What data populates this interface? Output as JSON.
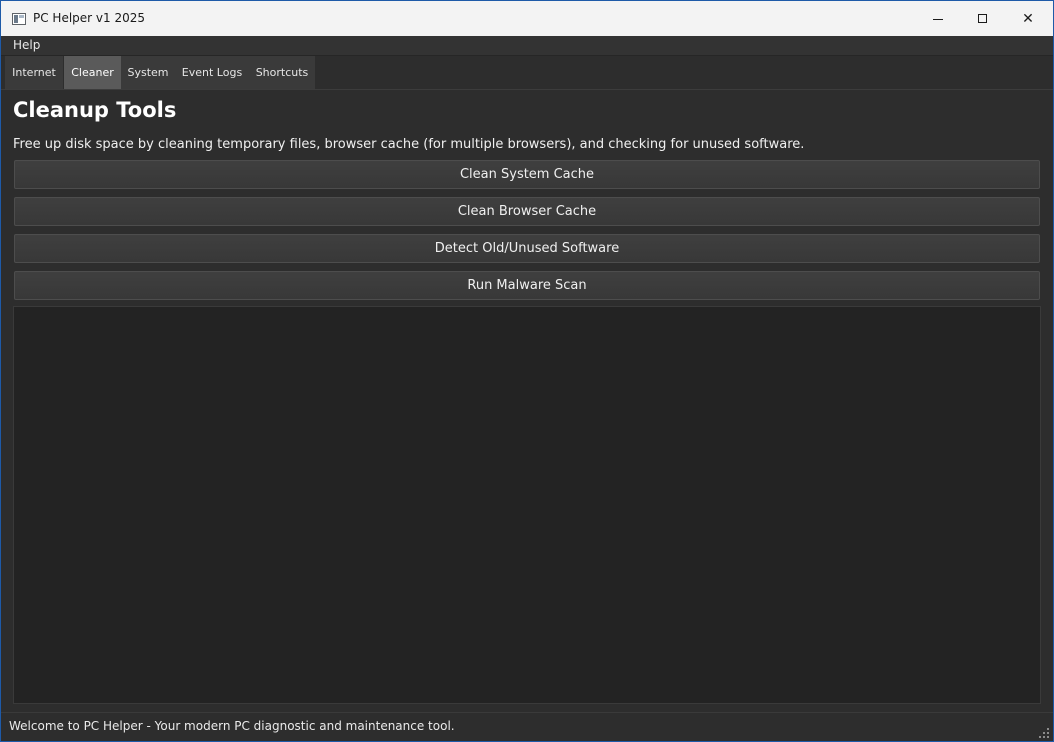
{
  "window": {
    "title": "PC Helper v1 2025",
    "icon": "app-window-icon",
    "controls": {
      "minimize_icon": "minimize-icon",
      "maximize_icon": "maximize-icon",
      "close_icon": "close-icon",
      "close_glyph": "✕"
    }
  },
  "menubar": {
    "items": [
      {
        "label": "Help"
      }
    ]
  },
  "tabs": [
    {
      "label": "Internet",
      "active": false
    },
    {
      "label": "Cleaner",
      "active": true
    },
    {
      "label": "System",
      "active": false
    },
    {
      "label": "Event Logs",
      "active": false
    },
    {
      "label": "Shortcuts",
      "active": false
    }
  ],
  "main": {
    "title": "Cleanup Tools",
    "description": "Free up disk space by cleaning temporary files, browser cache (for multiple browsers), and checking for unused software.",
    "buttons": [
      {
        "label": "Clean System Cache"
      },
      {
        "label": "Clean Browser Cache"
      },
      {
        "label": "Detect Old/Unused Software"
      },
      {
        "label": "Run Malware Scan"
      }
    ],
    "output": ""
  },
  "statusbar": {
    "text": "Welcome to PC Helper - Your modern PC diagnostic and maintenance tool.",
    "grip_icon": "resize-grip-icon"
  },
  "colors": {
    "accent_border": "#1e5aa8",
    "background": "#2d2d2d",
    "active_tab": "#5a5a5a",
    "text": "#f0f0f0"
  }
}
